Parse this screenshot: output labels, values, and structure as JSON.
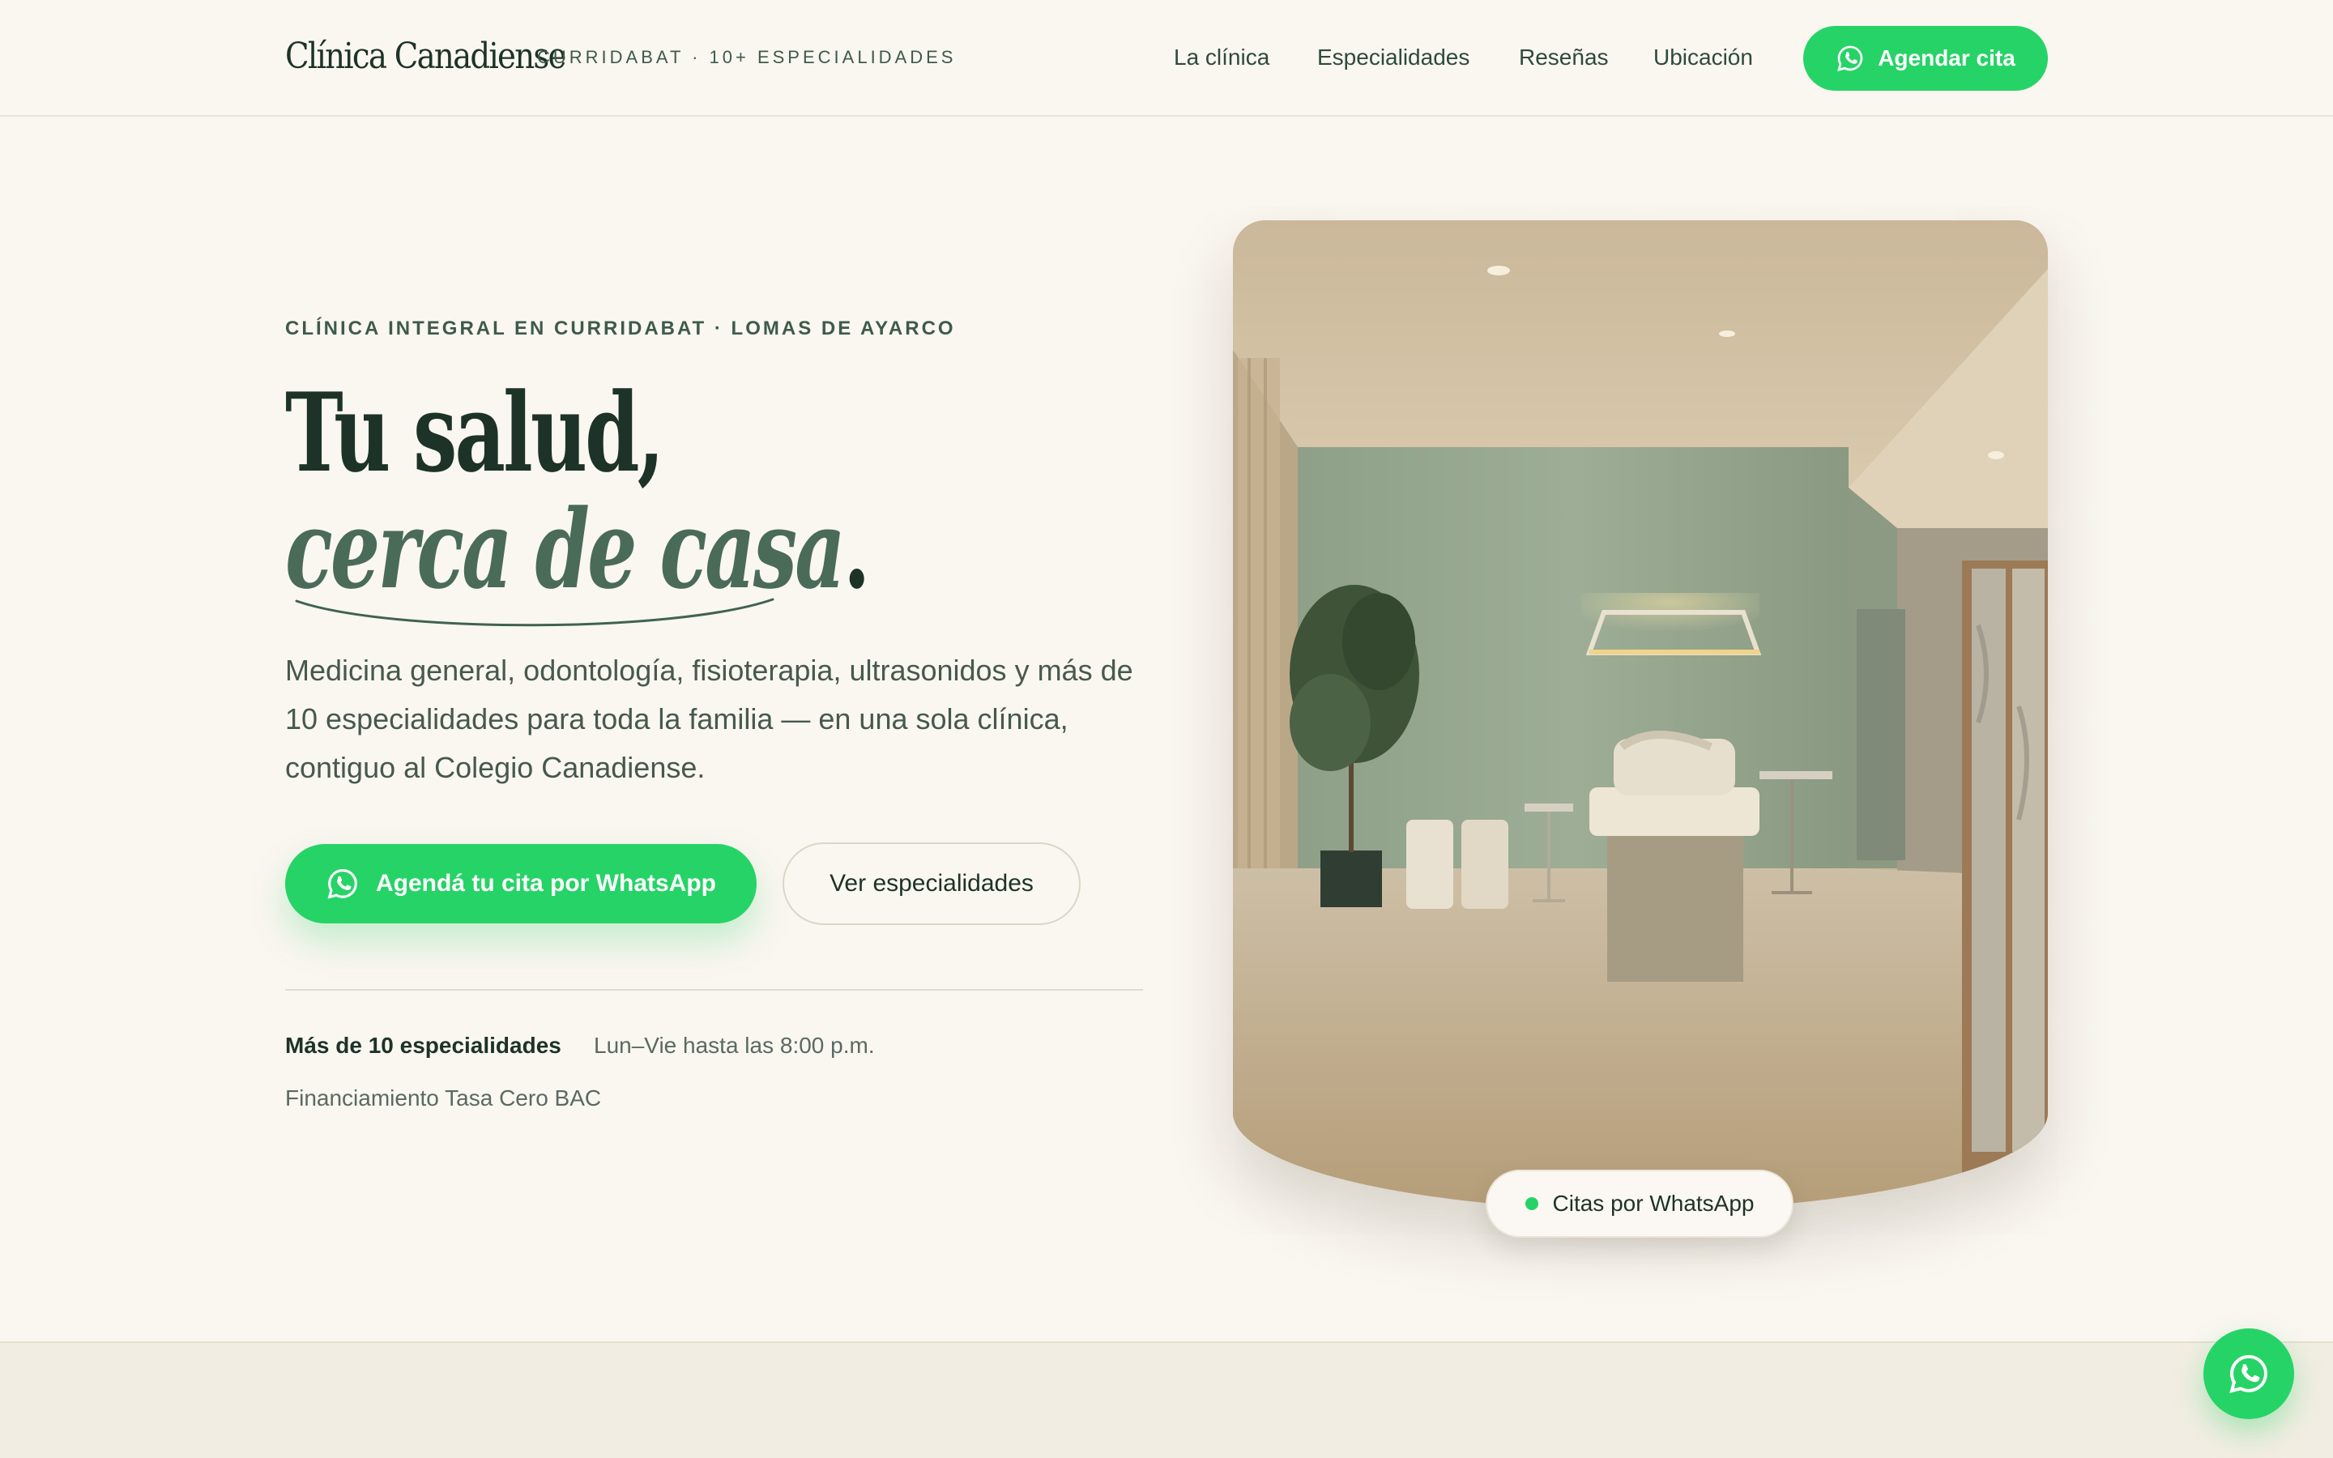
{
  "header": {
    "brand": "Clínica Canadiense",
    "tagline": "CURRIDABAT · 10+ ESPECIALIDADES",
    "nav": [
      "La clínica",
      "Especialidades",
      "Reseñas",
      "Ubicación"
    ],
    "cta_label": "Agendar cita"
  },
  "hero": {
    "eyebrow": "CLÍNICA INTEGRAL EN CURRIDABAT · LOMAS DE AYARCO",
    "title_line1": "Tu salud,",
    "title_line2": "cerca de casa",
    "title_punct": ".",
    "description": "Medicina general, odontología, fisioterapia, ultrasonidos y más de 10 especialidades para toda la familia — en una sola clínica, contiguo al Colegio Canadiense.",
    "primary_cta": "Agendá tu cita por WhatsApp",
    "secondary_cta": "Ver especialidades",
    "stats": [
      "Más de 10 especialidades",
      "Lun–Vie hasta las 8:00 p.m.",
      "Financiamiento Tasa Cero BAC"
    ],
    "badge": "Citas por WhatsApp"
  },
  "icons": {
    "whatsapp": "whatsapp-icon"
  },
  "colors": {
    "accent": "#25d366",
    "text_dark": "#1d3327",
    "text_green": "#4a6b58",
    "background": "#faf6f0"
  }
}
